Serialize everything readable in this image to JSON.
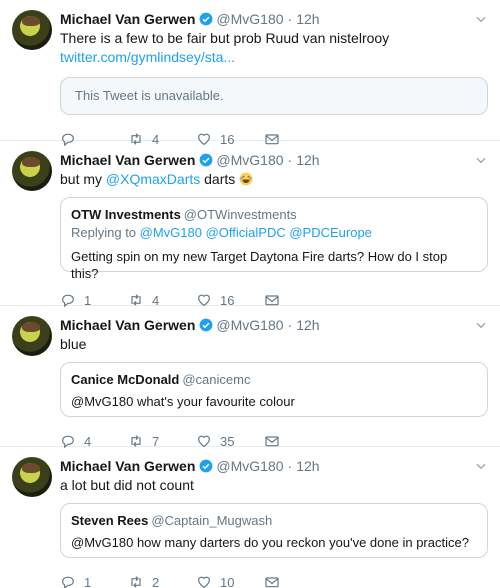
{
  "tweets": [
    {
      "name": "Michael Van Gerwen",
      "handle": "@MvG180",
      "time": "12h",
      "text_before": "There is a few to be fair but prob Ruud van nistelrooy ",
      "link": "twitter.com/gymlindsey/sta...",
      "unavailable": "This Tweet is unavailable.",
      "replies": "",
      "retweets": "4",
      "likes": "16"
    },
    {
      "name": "Michael Van Gerwen",
      "handle": "@MvG180",
      "time": "12h",
      "text_before": "but my ",
      "mention": "@XQmaxDarts",
      "text_after": " darts",
      "quote": {
        "name": "OTW Investments",
        "handle": "@OTWinvestments",
        "reply_prefix": "Replying to ",
        "reply_to": "@MvG180 @OfficialPDC @PDCEurope",
        "text": "Getting spin on my new Target Daytona Fire darts? How do I stop this?"
      },
      "replies": "1",
      "retweets": "4",
      "likes": "16"
    },
    {
      "name": "Michael Van Gerwen",
      "handle": "@MvG180",
      "time": "12h",
      "text": "blue",
      "quote": {
        "name": "Canice McDonald",
        "handle": "@canicemc",
        "text": "@MvG180 what's your favourite colour"
      },
      "replies": "4",
      "retweets": "7",
      "likes": "35"
    },
    {
      "name": "Michael Van Gerwen",
      "handle": "@MvG180",
      "time": "12h",
      "text": "a lot but did not count",
      "quote": {
        "name": "Steven Rees",
        "handle": "@Captain_Mugwash",
        "text": "@MvG180 how many darters do you reckon you've done in practice?"
      },
      "replies": "1",
      "retweets": "2",
      "likes": "10"
    }
  ],
  "dot": "·",
  "colors": {
    "link": "#1da1f2",
    "muted": "#657786",
    "border": "#e6ecf0",
    "verified": "#1da1f2"
  },
  "icons": [
    "verified-badge-icon",
    "chevron-down-icon",
    "reply-icon",
    "retweet-icon",
    "like-icon",
    "message-icon",
    "laughing-emoji-icon"
  ]
}
